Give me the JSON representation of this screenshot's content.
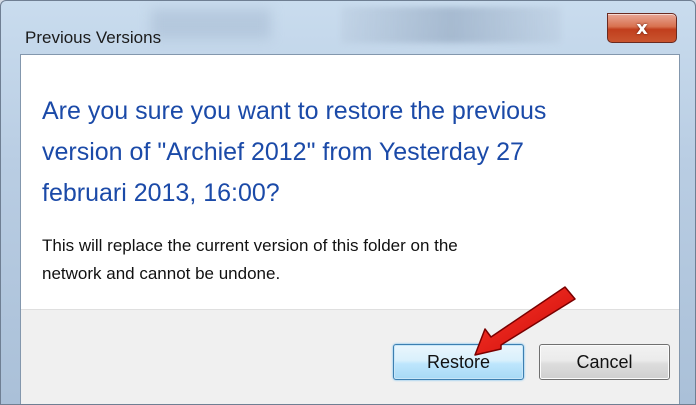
{
  "window": {
    "title": "Previous Versions",
    "close_glyph": "x"
  },
  "dialog": {
    "main_instruction": "Are you sure you want to restore the previous\nversion of \"Archief 2012\" from Yesterday 27\nfebruari 2013, 16:00?",
    "description": "This will replace the current version of this folder on the\nnetwork and cannot be undone."
  },
  "buttons": {
    "restore_label": "Restore",
    "cancel_label": "Cancel"
  },
  "annotation": {
    "icon": "red-arrow-icon",
    "color": "#e01010"
  },
  "colors": {
    "instruction_text": "#1b4aa8",
    "close_button": "#c13e1d",
    "default_button_border": "#3c7fb1"
  }
}
